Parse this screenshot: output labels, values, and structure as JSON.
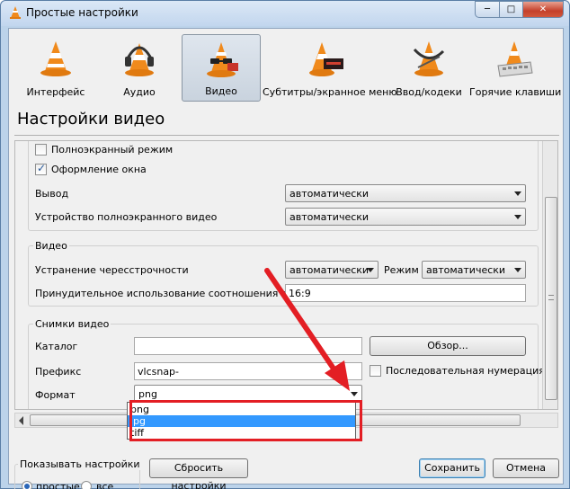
{
  "window": {
    "title": "Простые настройки",
    "controls": {
      "minimize": "─",
      "maximize": "□",
      "close": "✕"
    }
  },
  "categories": [
    {
      "label": "Интерфейс",
      "icon": "vlc-cone-icon"
    },
    {
      "label": "Аудио",
      "icon": "vlc-cone-headphones-icon"
    },
    {
      "label": "Видео",
      "icon": "vlc-cone-glasses-icon",
      "active": true
    },
    {
      "label": "Субтитры/экранное меню",
      "icon": "vlc-cone-subtitles-icon"
    },
    {
      "label": "Ввод/кодеки",
      "icon": "vlc-cone-cables-icon"
    },
    {
      "label": "Горячие клавиши",
      "icon": "vlc-cone-keyboard-icon"
    }
  ],
  "section_title": "Настройки видео",
  "display": {
    "fullscreen_label": "Полноэкранный режим",
    "fullscreen_checked": false,
    "decorations_label": "Оформление окна",
    "decorations_checked": true,
    "output_label": "Вывод",
    "output_value": "автоматически",
    "fullscreen_device_label": "Устройство полноэкранного видео",
    "fullscreen_device_value": "автоматически"
  },
  "video_group": {
    "title": "Видео",
    "deinterlace_label": "Устранение чересстрочности",
    "deinterlace_value": "автоматически",
    "mode_label": "Режим",
    "mode_value": "автоматически",
    "aspect_label": "Принудительное использование соотношения сторон",
    "aspect_value": "16:9"
  },
  "snapshots": {
    "title": "Снимки видео",
    "directory_label": "Каталог",
    "directory_value": "",
    "browse_label": "Обзор...",
    "prefix_label": "Префикс",
    "prefix_value": "vlcsnap-",
    "sequential_label": "Последовательная нумерация",
    "sequential_checked": false,
    "format_label": "Формат",
    "format_value": "png",
    "format_options": [
      "png",
      "jpg",
      "tiff"
    ],
    "format_highlighted": "jpg"
  },
  "footer": {
    "show_settings_label": "Показывать настройки",
    "simple_label": "простые",
    "all_label": "все",
    "reset_label": "Сбросить настройки",
    "save_label": "Сохранить",
    "cancel_label": "Отмена"
  },
  "colors": {
    "accent_highlight": "#e31e24",
    "selection": "#3399ff",
    "cone_orange": "#f08a1c"
  }
}
